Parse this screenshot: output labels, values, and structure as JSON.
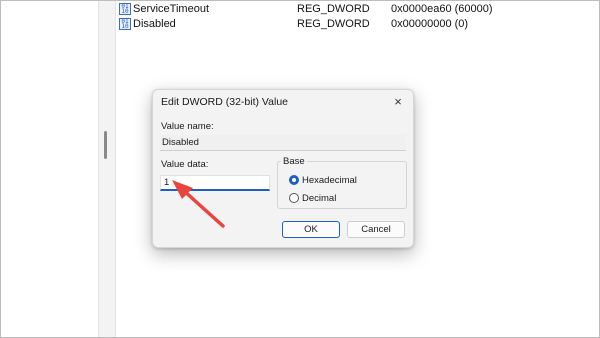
{
  "registry": {
    "rows": [
      {
        "name": "ServiceTimeout",
        "type": "REG_DWORD",
        "data": "0x0000ea60 (60000)"
      },
      {
        "name": "Disabled",
        "type": "REG_DWORD",
        "data": "0x00000000 (0)"
      }
    ]
  },
  "dialog": {
    "title": "Edit DWORD (32-bit) Value",
    "close_icon": "×",
    "value_name_label": "Value name:",
    "value_name": "Disabled",
    "value_data_label": "Value data:",
    "value_data": "1",
    "base_label": "Base",
    "base_options": [
      {
        "label": "Hexadecimal",
        "selected": true
      },
      {
        "label": "Decimal",
        "selected": false
      }
    ],
    "ok_label": "OK",
    "cancel_label": "Cancel"
  },
  "colors": {
    "accent": "#1f5fbf",
    "annotation_arrow": "#e8453c"
  }
}
